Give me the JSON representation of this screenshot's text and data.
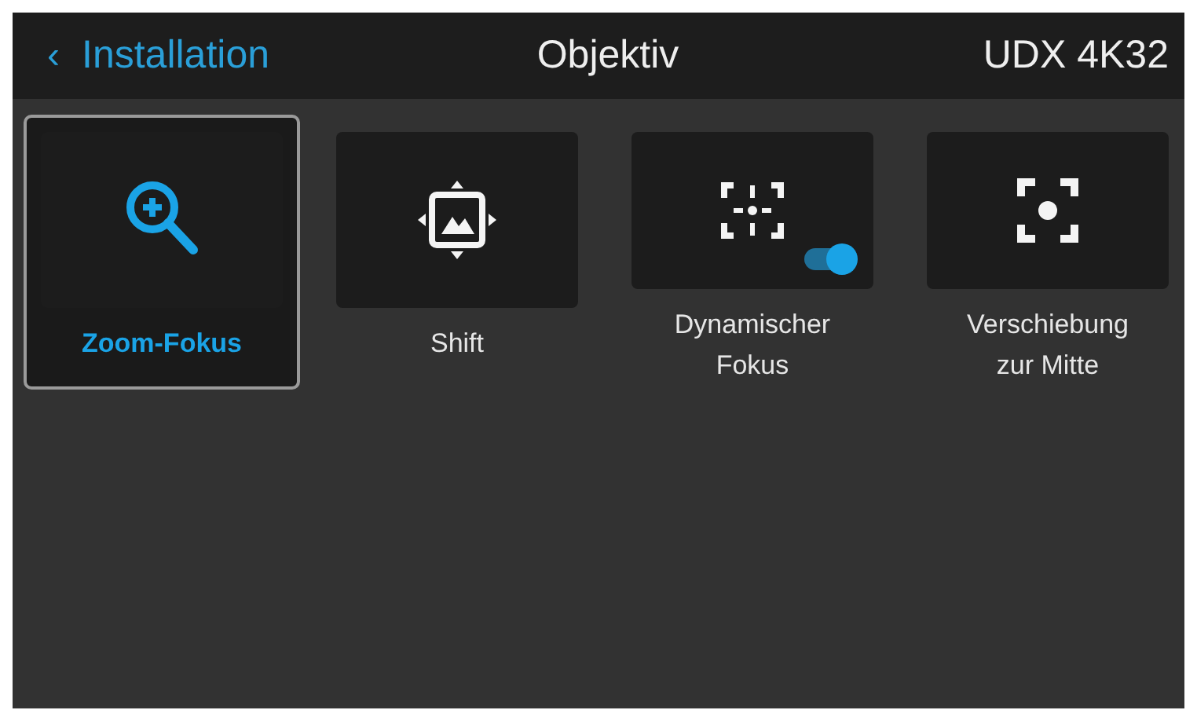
{
  "header": {
    "back_label": "Installation",
    "back_glyph": "‹",
    "title": "Objektiv",
    "device": "UDX 4K32"
  },
  "tiles": [
    {
      "label": "Zoom-Fokus",
      "kind": "zoom",
      "selected": true
    },
    {
      "label": "Shift",
      "kind": "shift",
      "selected": false
    },
    {
      "label": "Dynamischer Fokus",
      "kind": "dynamic",
      "selected": false,
      "toggle_on": true
    },
    {
      "label": "Verschiebung zur Mitte",
      "kind": "center",
      "selected": false
    }
  ]
}
